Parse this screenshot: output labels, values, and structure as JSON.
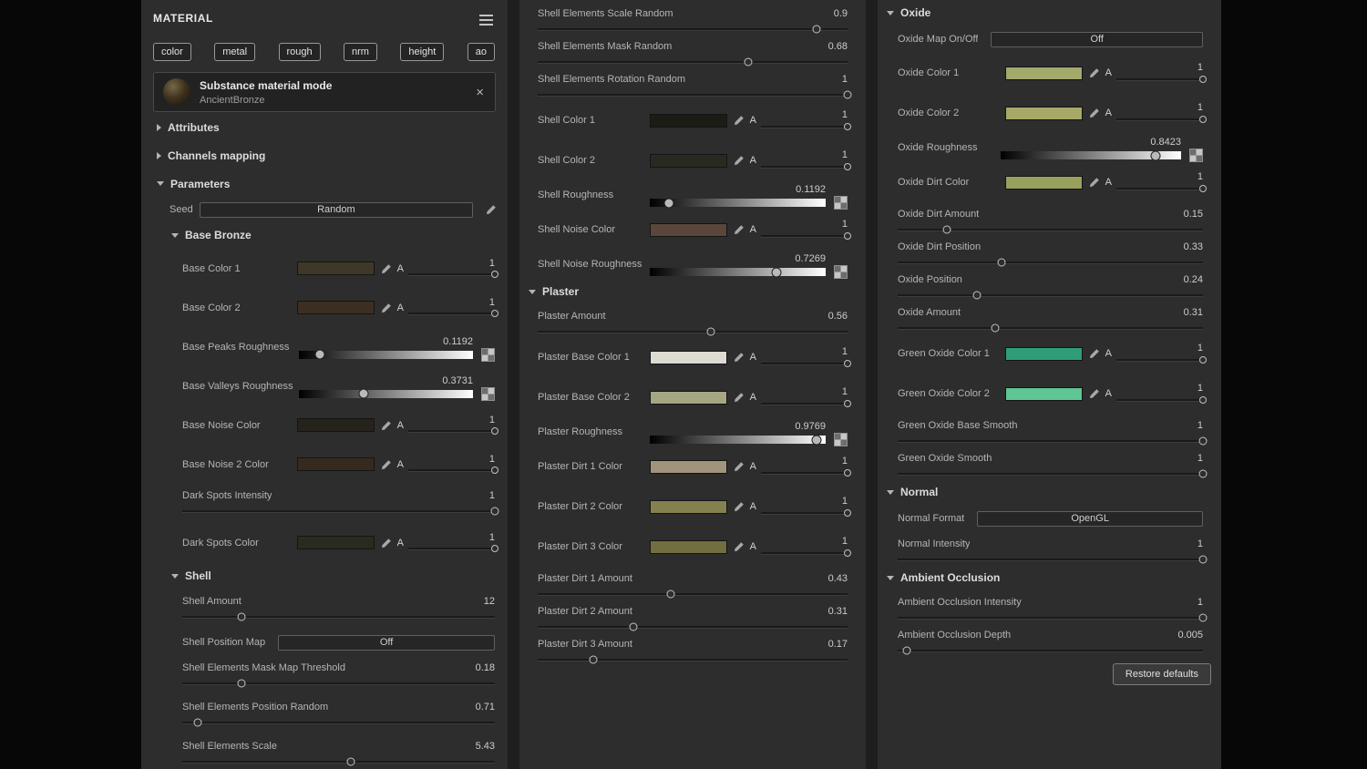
{
  "panel": {
    "title": "MATERIAL"
  },
  "columns": {
    "left": {
      "rows": [
        {
          "type": "title",
          "label": "MATERIAL"
        },
        {
          "type": "channels",
          "buttons": [
            "color",
            "metal",
            "rough",
            "nrm",
            "height",
            "ao"
          ]
        },
        {
          "type": "card",
          "title": "Substance material mode",
          "subtitle": "AncientBronze"
        },
        {
          "type": "section",
          "label": "Attributes",
          "expanded": false
        },
        {
          "type": "section",
          "label": "Channels mapping",
          "expanded": false
        },
        {
          "type": "section",
          "label": "Parameters",
          "expanded": true
        },
        {
          "type": "field",
          "label": "Seed",
          "value": "Random"
        },
        {
          "type": "subsection",
          "label": "Base Bronze",
          "expanded": true
        },
        {
          "type": "color",
          "label": "Base Color 1",
          "swatch": "#3d3828",
          "alpha": "1"
        },
        {
          "type": "color",
          "label": "Base Color 2",
          "swatch": "#3c2e21",
          "alpha": "1"
        },
        {
          "type": "gradient",
          "label": "Base Peaks Roughness",
          "value": "0.1192",
          "pos": 0.12
        },
        {
          "type": "gradient",
          "label": "Base Valleys Roughness",
          "value": "0.3731",
          "pos": 0.37
        },
        {
          "type": "color",
          "label": "Base Noise Color",
          "swatch": "#25231b",
          "alpha": "1"
        },
        {
          "type": "color",
          "label": "Base Noise 2 Color",
          "swatch": "#362a1e",
          "alpha": "1"
        },
        {
          "type": "slider",
          "label": "Dark Spots Intensity",
          "value": "1",
          "pos": 1
        },
        {
          "type": "color",
          "label": "Dark Spots Color",
          "swatch": "#2b2a21",
          "alpha": "1"
        },
        {
          "type": "subsection",
          "label": "Shell",
          "expanded": true
        },
        {
          "type": "slider",
          "label": "Shell Amount",
          "value": "12",
          "pos": 0.19
        },
        {
          "type": "button",
          "label": "Shell Position Map",
          "button": "Off"
        },
        {
          "type": "slider",
          "label": "Shell Elements Mask Map Threshold",
          "value": "0.18",
          "pos": 0.19
        },
        {
          "type": "slider",
          "label": "Shell Elements Position Random",
          "value": "0.71",
          "pos": 0.05
        },
        {
          "type": "slider",
          "label": "Shell Elements Scale",
          "value": "5.43",
          "pos": 0.54
        }
      ]
    },
    "middle": {
      "rows": [
        {
          "type": "slider",
          "label": "Shell Elements Scale Random",
          "value": "0.9",
          "pos": 0.9
        },
        {
          "type": "slider",
          "label": "Shell Elements Mask Random",
          "value": "0.68",
          "pos": 0.68
        },
        {
          "type": "slider",
          "label": "Shell Elements Rotation Random",
          "value": "1",
          "pos": 1
        },
        {
          "type": "color",
          "label": "Shell Color 1",
          "swatch": "#1c1c17",
          "alpha": "1"
        },
        {
          "type": "color",
          "label": "Shell Color 2",
          "swatch": "#2a2921",
          "alpha": "1"
        },
        {
          "type": "gradient",
          "label": "Shell Roughness",
          "value": "0.1192",
          "pos": 0.11
        },
        {
          "type": "color",
          "label": "Shell Noise Color",
          "swatch": "#5a463b",
          "alpha": "1"
        },
        {
          "type": "gradient",
          "label": "Shell Noise Roughness",
          "value": "0.7269",
          "pos": 0.72
        },
        {
          "type": "header",
          "label": "Plaster",
          "expanded": true
        },
        {
          "type": "slider",
          "label": "Plaster Amount",
          "value": "0.56",
          "pos": 0.56
        },
        {
          "type": "color",
          "label": "Plaster Base Color 1",
          "swatch": "#dddbd1",
          "alpha": "1"
        },
        {
          "type": "color",
          "label": "Plaster Base Color 2",
          "swatch": "#a6a683",
          "alpha": "1"
        },
        {
          "type": "gradient",
          "label": "Plaster Roughness",
          "value": "0.9769",
          "pos": 0.95
        },
        {
          "type": "color",
          "label": "Plaster Dirt 1 Color",
          "swatch": "#a2947c",
          "alpha": "1"
        },
        {
          "type": "color",
          "label": "Plaster Dirt 2 Color",
          "swatch": "#84814f",
          "alpha": "1"
        },
        {
          "type": "color",
          "label": "Plaster Dirt 3 Color",
          "swatch": "#716e41",
          "alpha": "1"
        },
        {
          "type": "slider",
          "label": "Plaster Dirt 1 Amount",
          "value": "0.43",
          "pos": 0.43
        },
        {
          "type": "slider",
          "label": "Plaster Dirt 2 Amount",
          "value": "0.31",
          "pos": 0.31
        },
        {
          "type": "slider",
          "label": "Plaster Dirt 3 Amount",
          "value": "0.17",
          "pos": 0.18
        }
      ]
    },
    "right": {
      "rows": [
        {
          "type": "header",
          "label": "Oxide",
          "expanded": true
        },
        {
          "type": "button",
          "label": "Oxide Map On/Off",
          "button": "Off"
        },
        {
          "type": "color",
          "label": "Oxide Color 1",
          "swatch": "#a2a96b",
          "alpha": "1"
        },
        {
          "type": "color",
          "label": "Oxide Color 2",
          "swatch": "#a6aa66",
          "alpha": "1"
        },
        {
          "type": "gradient",
          "label": "Oxide Roughness",
          "value": "0.8423",
          "pos": 0.86
        },
        {
          "type": "color",
          "label": "Oxide Dirt Color",
          "swatch": "#99a05e",
          "alpha": "1"
        },
        {
          "type": "slider",
          "label": "Oxide Dirt Amount",
          "value": "0.15",
          "pos": 0.16
        },
        {
          "type": "slider",
          "label": "Oxide Dirt Position",
          "value": "0.33",
          "pos": 0.34
        },
        {
          "type": "slider",
          "label": "Oxide Position",
          "value": "0.24",
          "pos": 0.26
        },
        {
          "type": "slider",
          "label": "Oxide Amount",
          "value": "0.31",
          "pos": 0.32
        },
        {
          "type": "color",
          "label": "Green Oxide Color 1",
          "swatch": "#2f9e78",
          "alpha": "1"
        },
        {
          "type": "color",
          "label": "Green Oxide Color 2",
          "swatch": "#5fc594",
          "alpha": "1"
        },
        {
          "type": "slider",
          "label": "Green Oxide Base Smooth",
          "value": "1",
          "pos": 1
        },
        {
          "type": "slider",
          "label": "Green Oxide Smooth",
          "value": "1",
          "pos": 1
        },
        {
          "type": "header",
          "label": "Normal",
          "expanded": true
        },
        {
          "type": "button",
          "label": "Normal Format",
          "button": "OpenGL"
        },
        {
          "type": "slider",
          "label": "Normal Intensity",
          "value": "1",
          "pos": 1
        },
        {
          "type": "header",
          "label": "Ambient Occlusion",
          "expanded": true
        },
        {
          "type": "slider",
          "label": "Ambient Occlusion Intensity",
          "value": "1",
          "pos": 1
        },
        {
          "type": "slider",
          "label": "Ambient Occlusion Depth",
          "value": "0.005",
          "pos": 0.03
        },
        {
          "type": "action",
          "label": "Restore defaults"
        }
      ]
    }
  }
}
